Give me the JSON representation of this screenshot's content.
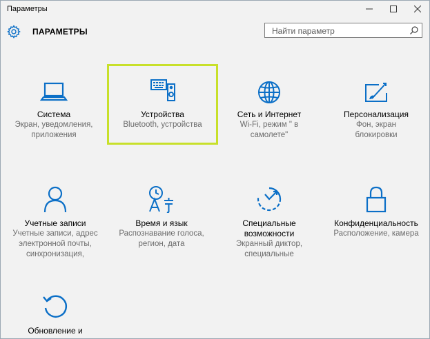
{
  "window": {
    "title": "Параметры",
    "controls": {
      "minimize": "—",
      "maximize": "☐",
      "close": "✕"
    }
  },
  "header": {
    "title": "ПАРАМЕТРЫ",
    "search_placeholder": "Найти параметр"
  },
  "colors": {
    "accent": "#0b6fc7",
    "selection": "#c8e02a",
    "desc": "#6b6b6b"
  },
  "tiles": [
    {
      "icon": "laptop-icon",
      "label": "Система",
      "desc1": "Экран, уведомления,",
      "desc2": "приложения",
      "desc3": ""
    },
    {
      "icon": "devices-icon",
      "label": "Устройства",
      "desc1": "Bluetooth, устройства",
      "desc2": "",
      "desc3": "",
      "selected": true
    },
    {
      "icon": "globe-icon",
      "label": "Сеть и Интернет",
      "desc1": "Wi-Fi, режим \" в",
      "desc2": "самолете\"",
      "desc3": ""
    },
    {
      "icon": "personalization-icon",
      "label": "Персонализация",
      "desc1": "Фон, экран",
      "desc2": "блокировки",
      "desc3": ""
    },
    {
      "icon": "person-icon",
      "label": "Учетные записи",
      "desc1": "Учетные записи, адрес",
      "desc2": "электронной почты,",
      "desc3": "синхронизация,"
    },
    {
      "icon": "time-language-icon",
      "label": "Время и язык",
      "desc1": "Распознавание голоса,",
      "desc2": "регион, дата",
      "desc3": ""
    },
    {
      "icon": "ease-of-access-icon",
      "label": "Специальные",
      "label2": "возможности",
      "desc1": "Экранный диктор,",
      "desc2": "специальные",
      "desc3": ""
    },
    {
      "icon": "lock-icon",
      "label": "Конфиденциальность",
      "desc1": "Расположение, камера",
      "desc2": "",
      "desc3": ""
    },
    {
      "icon": "update-icon",
      "label": "Обновление и",
      "desc1": "",
      "desc2": "",
      "desc3": ""
    }
  ]
}
